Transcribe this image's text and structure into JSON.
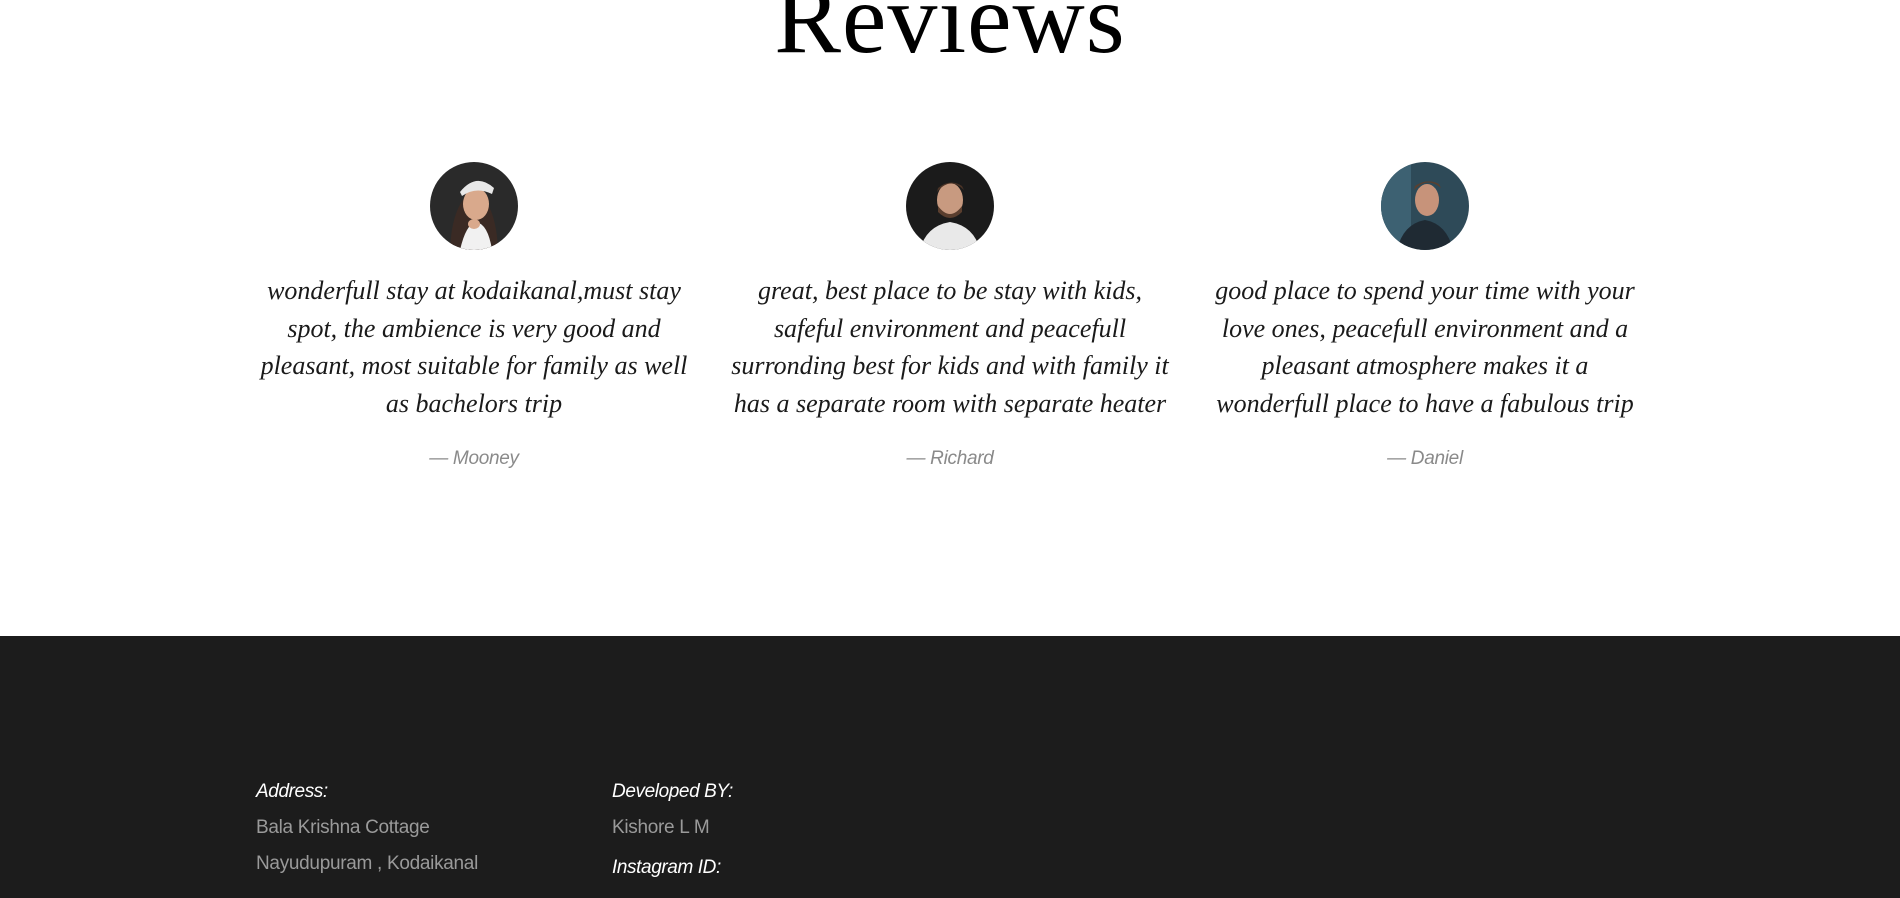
{
  "reviews": {
    "title": "Reviews",
    "items": [
      {
        "text": "wonderfull stay at kodaikanal,must stay spot, the ambience is very good and pleasant, most suitable for family as well as bachelors trip",
        "author": "— Mooney"
      },
      {
        "text": "great, best place to be stay with kids, safeful environment and peacefull surronding best for kids and with family it has a separate room with separate heater",
        "author": "— Richard"
      },
      {
        "text": "good place to spend your time with your love ones, peacefull environment and a pleasant atmosphere makes it a wonderfull place to have a fabulous trip",
        "author": "— Daniel"
      }
    ]
  },
  "footer": {
    "address_heading": "Address:",
    "address_line1": "Bala Krishna Cottage",
    "address_line2": "Nayudupuram , Kodaikanal",
    "developed_heading": "Developed BY:",
    "developer_name": "Kishore L M",
    "instagram_heading": "Instagram ID:"
  },
  "colors": {
    "footer_bg": "#1c1c1c",
    "author_gray": "#8a8a8a"
  }
}
